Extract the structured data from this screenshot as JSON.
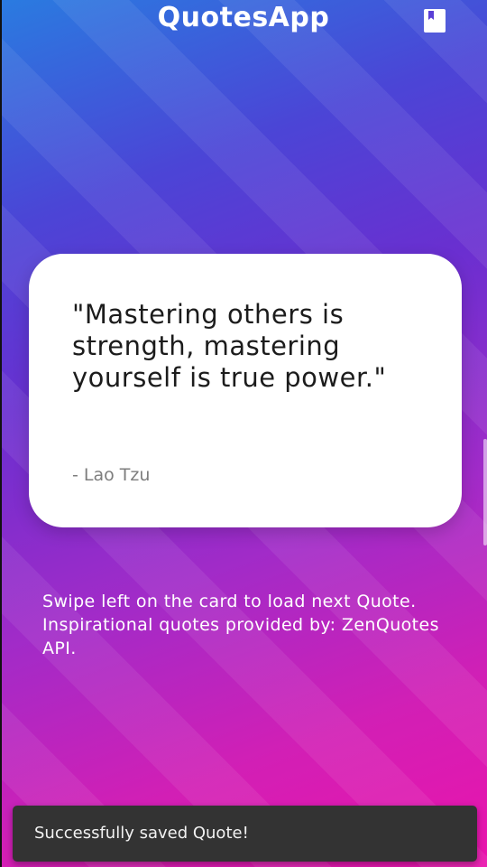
{
  "app": {
    "title": "QuotesApp"
  },
  "header": {
    "bookmark_icon": "bookmark-icon"
  },
  "quote_card": {
    "text": "\"Mastering others is strength, mastering yourself is true power.\"",
    "author": "- Lao Tzu"
  },
  "info": {
    "text": "Swipe left on the card to load next Quote. Inspirational quotes provided by: ZenQuotes API."
  },
  "snackbar": {
    "message": "Successfully saved Quote!"
  },
  "colors": {
    "gradient_top": "#2a7be0",
    "gradient_mid": "#6a2fd0",
    "gradient_bottom": "#ea14ac",
    "card": "#ffffff",
    "snackbar": "#333333"
  }
}
